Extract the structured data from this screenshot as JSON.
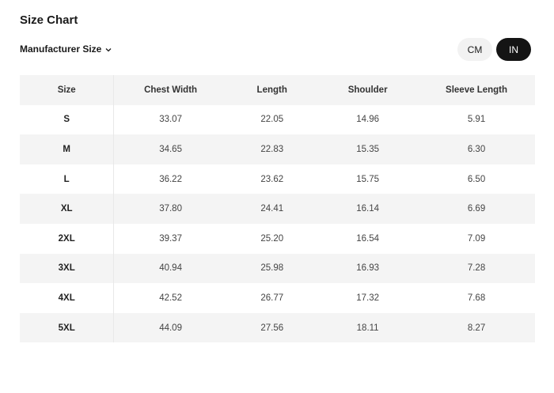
{
  "title": "Size Chart",
  "size_selector": {
    "label": "Manufacturer Size",
    "icon": "chevron-down-icon"
  },
  "units": {
    "cm": "CM",
    "in": "IN",
    "active": "IN"
  },
  "table": {
    "headers": [
      "Size",
      "Chest Width",
      "Length",
      "Shoulder",
      "Sleeve Length"
    ],
    "rows": [
      [
        "S",
        "33.07",
        "22.05",
        "14.96",
        "5.91"
      ],
      [
        "M",
        "34.65",
        "22.83",
        "15.35",
        "6.30"
      ],
      [
        "L",
        "36.22",
        "23.62",
        "15.75",
        "6.50"
      ],
      [
        "XL",
        "37.80",
        "24.41",
        "16.14",
        "6.69"
      ],
      [
        "2XL",
        "39.37",
        "25.20",
        "16.54",
        "7.09"
      ],
      [
        "3XL",
        "40.94",
        "25.98",
        "16.93",
        "7.28"
      ],
      [
        "4XL",
        "42.52",
        "26.77",
        "17.32",
        "7.68"
      ],
      [
        "5XL",
        "44.09",
        "27.56",
        "18.11",
        "8.27"
      ]
    ]
  },
  "colors": {
    "active_unit_bg": "#141414",
    "inactive_unit_bg": "#f2f2f2",
    "stripe": "#f4f4f4"
  }
}
